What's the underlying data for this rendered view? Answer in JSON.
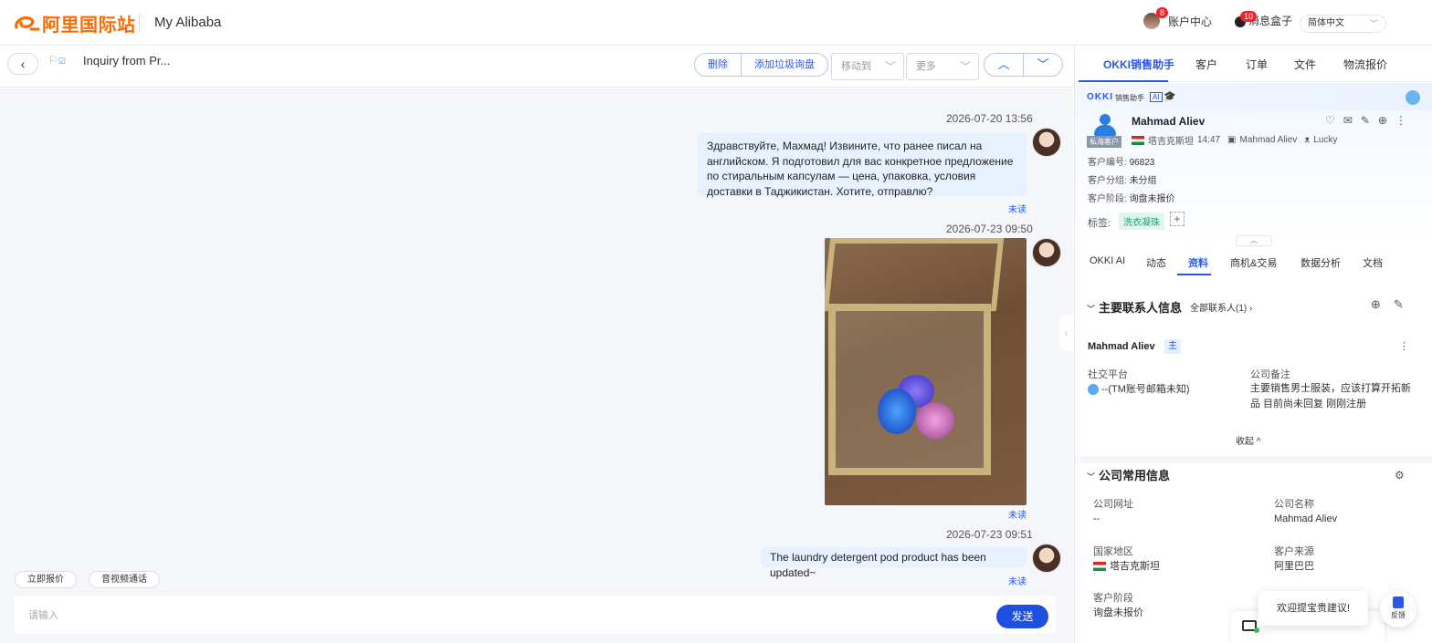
{
  "topbar": {
    "logo_text": "阿里国际站",
    "site_title": "My Alibaba",
    "account_label": "账户中心",
    "account_badge": "8",
    "inbox_label": "消息盒子",
    "inbox_badge": "10",
    "language": "简体中文"
  },
  "chat_header": {
    "title": "Inquiry from Pr...",
    "delete_label": "删除",
    "spam_label": "添加垃圾询盘",
    "move_placeholder": "移动到",
    "more_placeholder": "更多"
  },
  "messages": [
    {
      "timestamp": "2026-07-20 13:56",
      "text": "Здравствуйте, Махмад! Извините, что ранее писал на английском. Я подготовил для вас конкретное предложение по стиральным капсулам — цена, упаковка, условия доставки в Таджикистан. Хотите, отправлю?",
      "status": "未读"
    },
    {
      "timestamp": "2026-07-23 09:50",
      "image": "laundry-pods-photo",
      "status": "未读"
    },
    {
      "timestamp": "2026-07-23 09:51",
      "text": "The laundry detergent pod product has been updated~",
      "status": "未读"
    }
  ],
  "composer": {
    "quick_quote": "立即报价",
    "video_call": "音视频通话",
    "placeholder": "请输入",
    "send_label": "发送"
  },
  "right_panel": {
    "tabs": [
      "OKKI销售助手",
      "客户",
      "订单",
      "文件",
      "物流报价"
    ],
    "okki_brand": "OKKI",
    "okki_sub": "销售助手",
    "okki_ai": "AI",
    "customer": {
      "name": "Mahmad Aliev",
      "private_tag": "私海客户",
      "country": "塔吉克斯坦",
      "local_time": "14:47",
      "contact_name": "Mahmad Aliev",
      "owner": "Lucky",
      "customer_id_label": "客户编号:",
      "customer_id": "96823",
      "group_label": "客户分组:",
      "group": "未分组",
      "stage_label": "客户阶段:",
      "stage": "询盘未报价",
      "tags_label": "标签:",
      "tag": "洗衣凝珠"
    },
    "sub_tabs": [
      "OKKI AI",
      "动态",
      "资料",
      "商机&交易",
      "数据分析",
      "文档"
    ],
    "primary_contact": {
      "section_title": "主要联系人信息",
      "all_contacts": "全部联系人(1)",
      "name": "Mahmad Aliev",
      "main_tag": "主",
      "social_label": "社交平台",
      "social_value": "--(TM账号邮箱未知)",
      "note_label": "公司备注",
      "note_value": "主要销售男士服装，应该打算开拓新品 目前尚未回复 刚刚注册",
      "collapse": "收起"
    },
    "company_info": {
      "section_title": "公司常用信息",
      "website_label": "公司网址",
      "website": "--",
      "name_label": "公司名称",
      "name": "Mahmad Aliev",
      "region_label": "国家地区",
      "region": "塔吉克斯坦",
      "source_label": "客户来源",
      "source": "阿里巴巴",
      "stage_label": "客户阶段",
      "stage": "询盘未报价"
    }
  },
  "floating": {
    "suggestion": "欢迎提宝贵建议!",
    "feedback": "反馈"
  },
  "colors": {
    "accent": "#2b58e3",
    "brand": "#ff6a00",
    "send": "#1d4fe0",
    "bubble": "#e8f1ff"
  }
}
